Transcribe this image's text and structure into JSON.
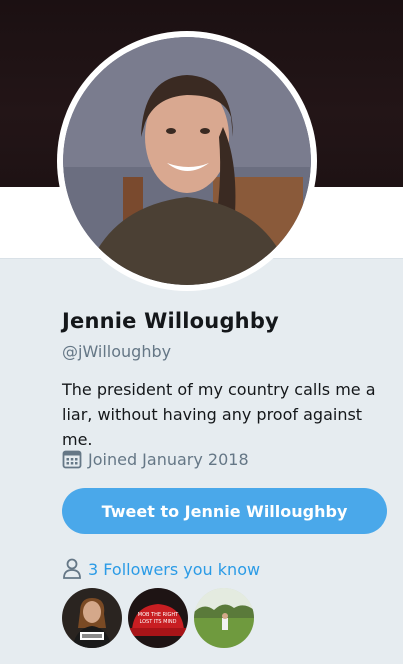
{
  "profile": {
    "name": "Jennie Willoughby",
    "handle": "@jWilloughby",
    "bio": "The president of my country calls me a liar, without having any proof against me.",
    "joined": "Joined January 2018"
  },
  "actions": {
    "tweet_to": "Tweet to Jennie Willoughby"
  },
  "followers": {
    "link_text": "3 Followers you know",
    "thumb2_text": "MOB THE RIGHT LOST ITS MIND"
  },
  "icons": {
    "calendar": "calendar-icon",
    "person": "person-icon"
  },
  "colors": {
    "accent": "#4aa8ea",
    "link": "#2b9be6",
    "background": "#e6ecf0",
    "muted": "#657786"
  }
}
